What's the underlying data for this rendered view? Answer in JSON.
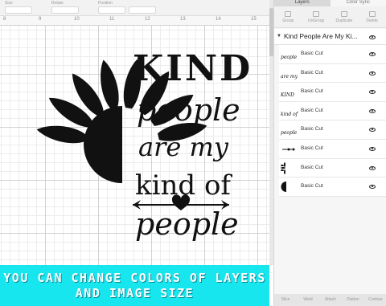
{
  "toolbar": {
    "fields": [
      {
        "label": "Size",
        "value": ""
      },
      {
        "label": "Rotate",
        "value": ""
      },
      {
        "label": "Position",
        "value": ""
      }
    ]
  },
  "ruler": {
    "numbers": [
      "8",
      "9",
      "10",
      "11",
      "12",
      "13",
      "14",
      "15"
    ]
  },
  "design": {
    "line1": "KIND",
    "line2": "people",
    "line3": "are my",
    "line4": "kind of",
    "line5": "people",
    "color": "#111111"
  },
  "panel": {
    "tabs": [
      "Layers",
      "Color Sync"
    ],
    "tools": [
      "Group",
      "UnGroup",
      "Duplicate",
      "Delete"
    ],
    "group_title": "Kind People Are My Ki...",
    "layers": [
      {
        "thumb_text": "people",
        "name": "Basic Cut",
        "thumb": "text"
      },
      {
        "thumb_text": "are my",
        "name": "Basic Cut",
        "thumb": "text"
      },
      {
        "thumb_text": "KIND",
        "name": "Basic Cut",
        "thumb": "text"
      },
      {
        "thumb_text": "kind of",
        "name": "Basic Cut",
        "thumb": "text"
      },
      {
        "thumb_text": "people",
        "name": "Basic Cut",
        "thumb": "text"
      },
      {
        "thumb_text": "",
        "name": "Basic Cut",
        "thumb": "arrow"
      },
      {
        "thumb_text": "",
        "name": "Basic Cut",
        "thumb": "petals"
      },
      {
        "thumb_text": "",
        "name": "Basic Cut",
        "thumb": "half-circle"
      }
    ],
    "bottom": [
      "Slice",
      "Weld",
      "Attach",
      "Flatten",
      "Contour"
    ]
  },
  "banner": {
    "line1": "YOU CAN CHANGE COLORS OF LAYERS",
    "line2": "AND IMAGE SIZE",
    "background": "#17e6ef"
  }
}
